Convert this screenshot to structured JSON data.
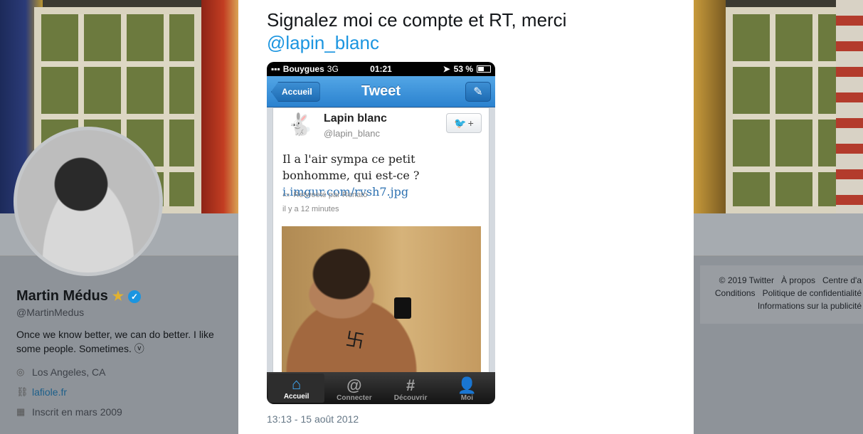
{
  "profile": {
    "name": "Martin Médus",
    "handle": "@MartinMedus",
    "bio": "Once we know better, we can do better. I like some people. Sometimes. ⓥ",
    "location": "Los Angeles, CA",
    "website": "lafiole.fr",
    "joined": "Inscrit en mars 2009"
  },
  "footer": {
    "copyright": "© 2019 Twitter",
    "about": "À propos",
    "help": "Centre d'a",
    "terms": "Conditions",
    "privacy": "Politique de confidentialité",
    "ads": "Informations sur la publicité"
  },
  "tweet": {
    "text": "Signalez moi ce compte et RT, merci",
    "mention": "@lapin_blanc",
    "timestamp": "13:13 - 15 août 2012"
  },
  "screenshot": {
    "status": {
      "carrier": "Bouygues",
      "network": "3G",
      "time": "01:21",
      "battery": "53 %"
    },
    "nav": {
      "back": "Accueil",
      "title": "Tweet"
    },
    "card": {
      "name": "Lapin blanc",
      "handle": "@lapin_blanc",
      "text": "Il a l'air sympa ce petit bonhomme, qui est-ce ?",
      "link": "i.imgur.com/rvsh7.jpg",
      "retweeted": "Retweeté par Renato",
      "time": "il y a 12 minutes"
    },
    "tabs": [
      {
        "label": "Accueil",
        "icon": "⌂"
      },
      {
        "label": "Connecter",
        "icon": "@"
      },
      {
        "label": "Découvrir",
        "icon": "#"
      },
      {
        "label": "Moi",
        "icon": "👤"
      }
    ]
  },
  "colors": {
    "accent": "#1b95e0"
  }
}
